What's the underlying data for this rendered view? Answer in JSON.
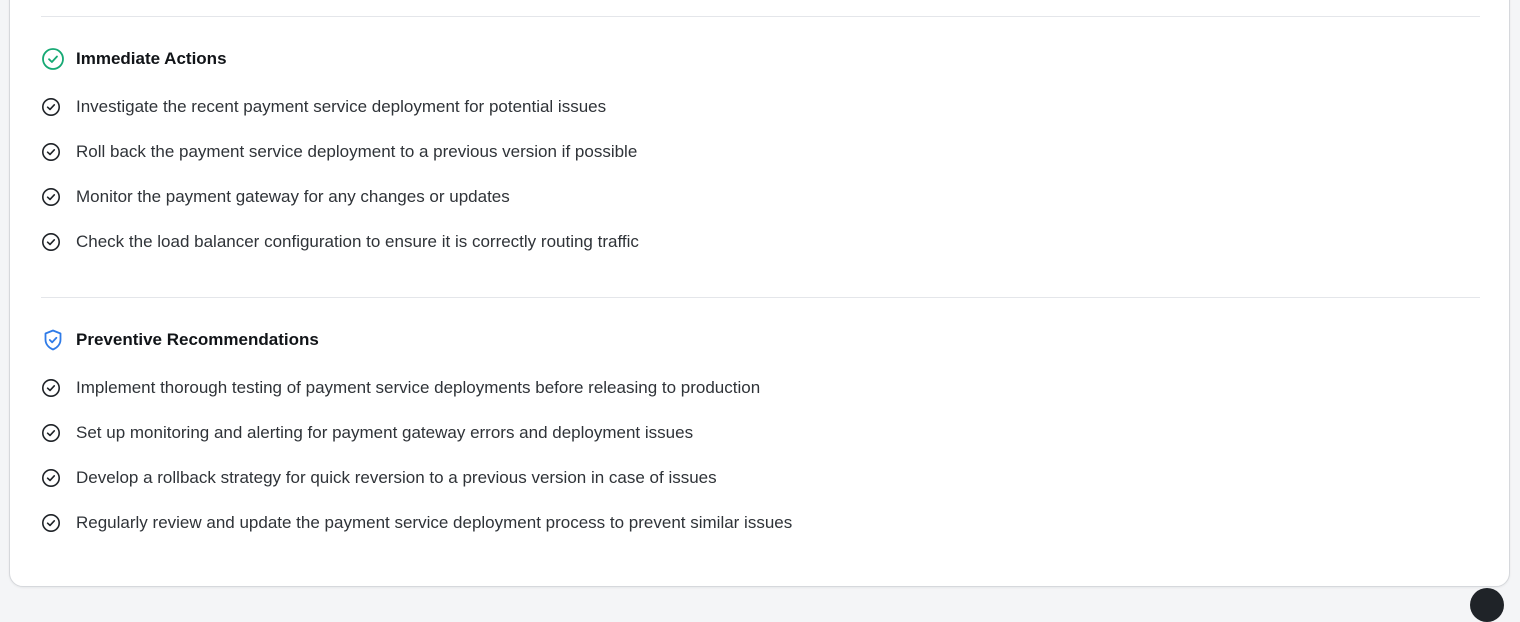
{
  "immediate_actions": {
    "title": "Immediate Actions",
    "icon": "check-circle-icon",
    "icon_color": "#16a974",
    "items": [
      "Investigate the recent payment service deployment for potential issues",
      "Roll back the payment service deployment to a previous version if possible",
      "Monitor the payment gateway for any changes or updates",
      "Check the load balancer configuration to ensure it is correctly routing traffic"
    ]
  },
  "preventive_recommendations": {
    "title": "Preventive Recommendations",
    "icon": "shield-check-icon",
    "icon_color": "#2f7be8",
    "items": [
      "Implement thorough testing of payment service deployments before releasing to production",
      "Set up monitoring and alerting for payment gateway errors and deployment issues",
      "Develop a rollback strategy for quick reversion to a previous version in case of issues",
      "Regularly review and update the payment service deployment process to prevent similar issues"
    ]
  },
  "item_icon": "check-circle-icon",
  "item_icon_color": "#1f2328"
}
